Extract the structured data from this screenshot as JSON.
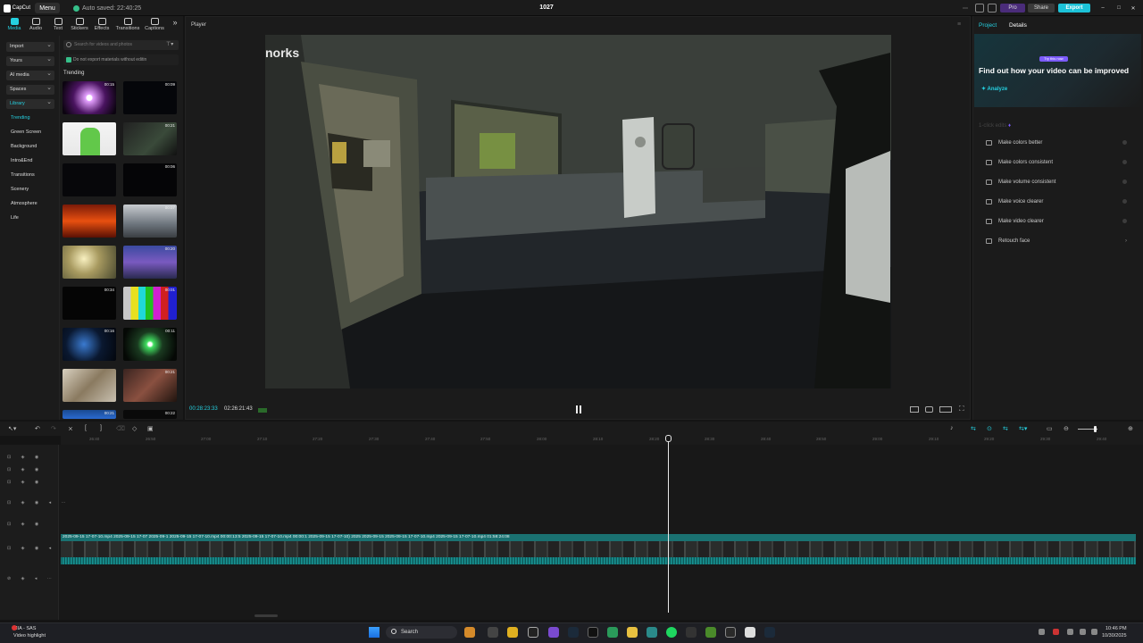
{
  "app": {
    "logo_label": "CapCut",
    "menu_label": "Menu",
    "autosave": "Auto saved: 22:40:25",
    "project_name": "1027",
    "pro_label": "Pro",
    "share_label": "Share",
    "export_label": "Export"
  },
  "media_tabs": [
    "Media",
    "Audio",
    "Text",
    "Stickers",
    "Effects",
    "Transitions",
    "Captions"
  ],
  "left_categories": {
    "dropdowns": [
      "Import",
      "Yours",
      "AI media",
      "Spaces",
      "Library"
    ],
    "items": [
      "Trending",
      "Green Screen",
      "Background",
      "Intro&End",
      "Transitions",
      "Scenery",
      "Atmosphere",
      "Life"
    ]
  },
  "media_panel": {
    "search_placeholder": "Search for videos and photos",
    "no_export_note": "Do not export materials without editin",
    "section_title": "Trending",
    "thumb_durations": [
      "00:15",
      "00:09",
      "",
      "00:21",
      "",
      "00:06",
      "",
      "00:07",
      "",
      "00:20",
      "00:34",
      "00:01",
      "00:16",
      "00:11",
      "",
      "00:21",
      "00:21",
      "00:22"
    ]
  },
  "player": {
    "title": "Player",
    "video_sign_text": "norks",
    "current_time": "00:28:23:33",
    "total_time": "02:26:21:43"
  },
  "right_panel": {
    "tab_project": "Project",
    "tab_details": "Details",
    "try_badge": "Try this now",
    "promo_title": "Find out how your video can be improved",
    "analyze_label": "Analyze",
    "oneclick_label": "1-click edits",
    "items": [
      "Make colors better",
      "Make colors consistent",
      "Make volume consistent",
      "Make voice clearer",
      "Make video clearer",
      "Retouch face"
    ]
  },
  "timeline": {
    "ruler_labels": [
      "26:40",
      "26:50",
      "27:00",
      "27:10",
      "27:20",
      "27:30",
      "27:40",
      "27:50",
      "28:00",
      "28:10",
      "28:20",
      "28:30",
      "28:40",
      "28:50",
      "29:00",
      "29:10",
      "29:20",
      "29:30",
      "29:40"
    ],
    "clip_labels": "2025-09-15 17-07-10.mp4   2025-09-15 17-07   2025-09-1   2025-09-15 17-07-10.mp4   00:00:13:5   2025-09-15 17-07-10.mp4   00:00:1   2025-09-15 17-07-10)   2025   2025-09-15   2025-09-15 17-07-10.mp4   2025-09-15 17-07-10.mp4   01:58:24:08"
  },
  "taskbar": {
    "news_title": "MIA - SAS",
    "news_subtitle": "Video highlight",
    "search_label": "Search",
    "time": "10:46 PM",
    "date": "10/30/2025"
  },
  "colors": {
    "accent": "#25d0e0",
    "export": "#1cc2d8",
    "clip": "#1a7171"
  }
}
